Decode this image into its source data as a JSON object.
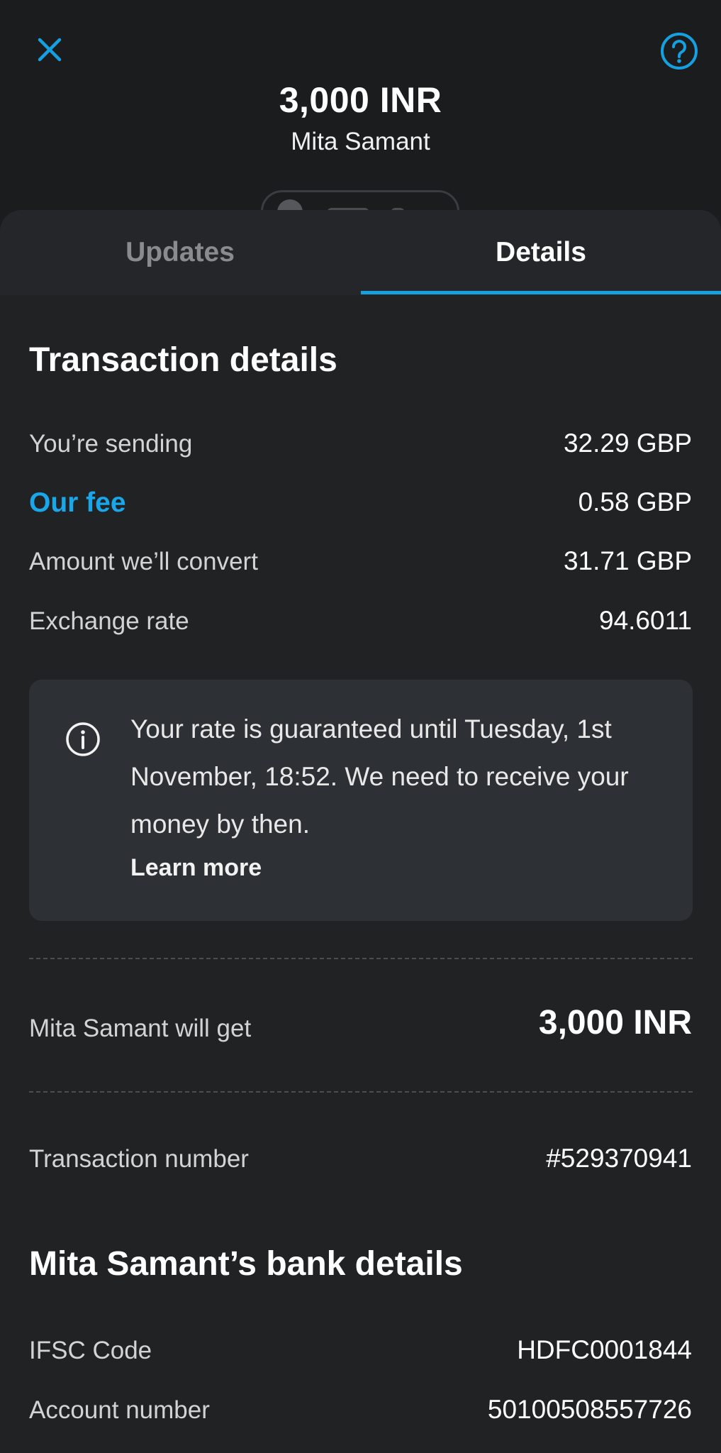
{
  "header": {
    "amount": "3,000 INR",
    "recipient": "Mita Samant"
  },
  "tabs": [
    {
      "label": "Updates",
      "active": false
    },
    {
      "label": "Details",
      "active": true
    }
  ],
  "transaction": {
    "title": "Transaction details",
    "rows": [
      {
        "label": "You’re sending",
        "value": "32.29 GBP"
      },
      {
        "label": "Our fee",
        "value": "0.58 GBP"
      },
      {
        "label": "Amount we’ll convert",
        "value": "31.71 GBP"
      },
      {
        "label": "Exchange rate",
        "value": "94.6011"
      }
    ],
    "info": {
      "text": "Your rate is guaranteed until Tuesday, 1st November, 18:52. We need to receive your money by then.",
      "link": "Learn more"
    },
    "recipient_gets": {
      "label": "Mita Samant will get",
      "value": "3,000 INR"
    },
    "number": {
      "label": "Transaction number",
      "value": "#529370941"
    }
  },
  "bank": {
    "title": "Mita Samant’s bank details",
    "rows": [
      {
        "label": "IFSC Code",
        "value": "HDFC0001844"
      },
      {
        "label": "Account number",
        "value": "50100508557726"
      }
    ]
  },
  "colors": {
    "accent": "#16a0df",
    "background": "#1b1c1e",
    "sheet": "#212224",
    "info_box": "#2d3034"
  },
  "icons": {
    "close": "close-icon",
    "help": "help-circle-icon",
    "info": "info-circle-icon"
  }
}
